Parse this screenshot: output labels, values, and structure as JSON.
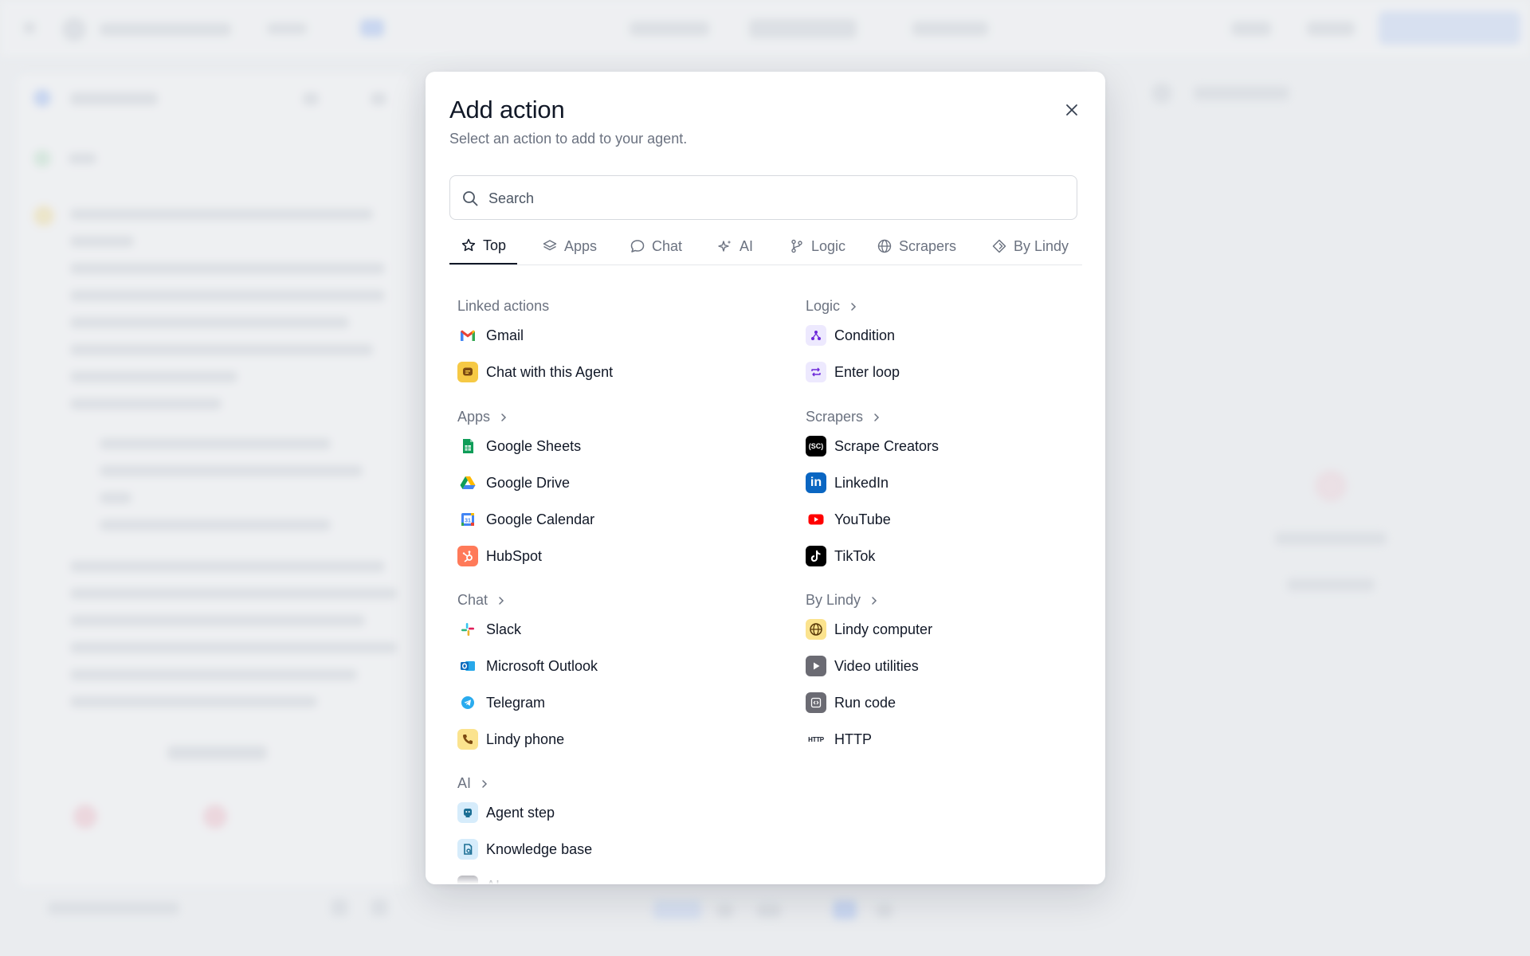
{
  "modal": {
    "title": "Add action",
    "subtitle": "Select an action to add to your agent.",
    "search_placeholder": "Search",
    "tabs": [
      {
        "label": "Top",
        "icon": "star-icon",
        "active": true
      },
      {
        "label": "Apps",
        "icon": "layers-icon"
      },
      {
        "label": "Chat",
        "icon": "chat-bubble-icon"
      },
      {
        "label": "AI",
        "icon": "sparkles-icon"
      },
      {
        "label": "Logic",
        "icon": "git-branch-icon"
      },
      {
        "label": "Scrapers",
        "icon": "globe-icon"
      },
      {
        "label": "By Lindy",
        "icon": "diamond-icon"
      }
    ],
    "sections": {
      "linked": {
        "title": "Linked actions",
        "items": [
          "Gmail",
          "Chat with this Agent"
        ]
      },
      "apps": {
        "title": "Apps",
        "items": [
          "Google Sheets",
          "Google Drive",
          "Google Calendar",
          "HubSpot"
        ]
      },
      "chat": {
        "title": "Chat",
        "items": [
          "Slack",
          "Microsoft Outlook",
          "Telegram",
          "Lindy phone"
        ]
      },
      "ai": {
        "title": "AI",
        "items": [
          "Agent step",
          "Knowledge base",
          "AI"
        ]
      },
      "logic": {
        "title": "Logic",
        "items": [
          "Condition",
          "Enter loop"
        ]
      },
      "scrapers": {
        "title": "Scrapers",
        "items": [
          "Scrape Creators",
          "LinkedIn",
          "YouTube",
          "TikTok"
        ]
      },
      "bylindy": {
        "title": "By Lindy",
        "items": [
          "Lindy computer",
          "Video utilities",
          "Run code",
          "HTTP"
        ]
      }
    },
    "icon_text": {
      "scrape_creators": "(SC)",
      "linkedin": "in",
      "http": "HTTP"
    }
  },
  "colors": {
    "accent": "#3b82f6",
    "text": "#111827",
    "muted": "#6b7280",
    "border": "#e5e7eb"
  }
}
